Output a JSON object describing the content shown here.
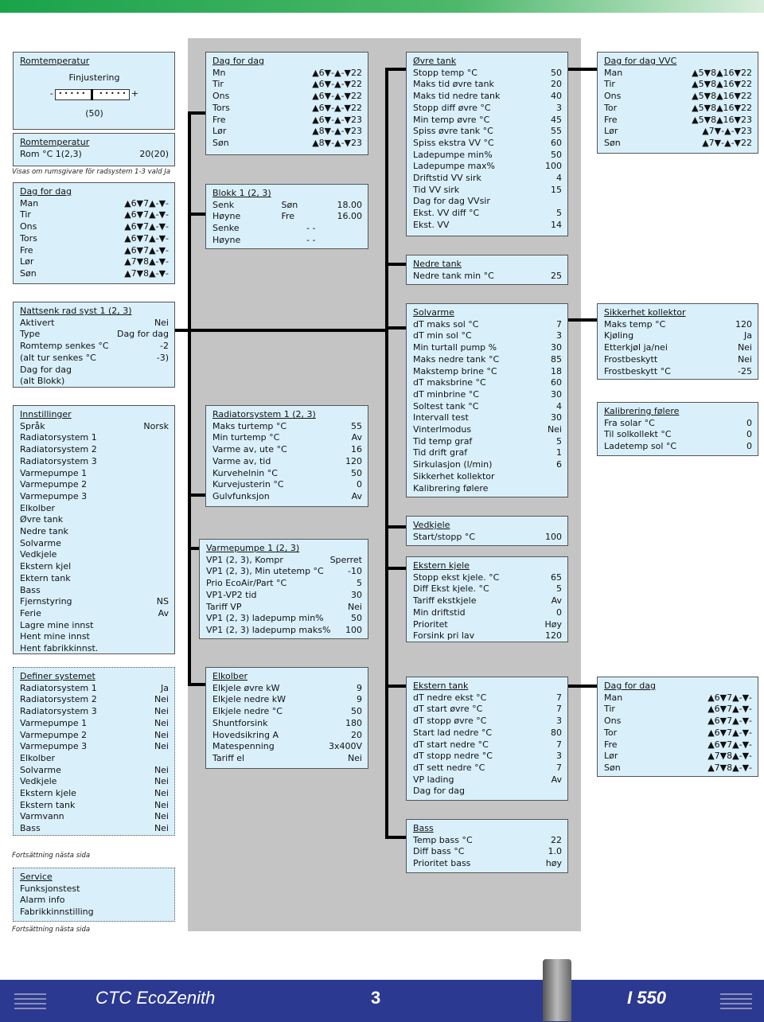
{
  "fine": {
    "title": "Romtemperatur",
    "subtitle": "Finjustering",
    "minus": "-",
    "plus": "+",
    "dots": "• • • • •",
    "value": "(50)"
  },
  "room": {
    "title": "Romtemperatur",
    "label": "Rom °C 1(2,3)",
    "value": "20(20)"
  },
  "room_note": "Visas om rumsgivare för radsystem 1-3 vald Ja",
  "cont_note_1": "Fortsättning nästa sida",
  "cont_note_2": "Fortsättning nästa sida",
  "boxes": [
    {
      "id": "dag-for-dag-1",
      "title": "Dag for dag",
      "rows": [
        [
          "Man",
          "",
          "▲6▼7▲-▼-"
        ],
        [
          "Tir",
          "",
          "▲6▼7▲-▼-"
        ],
        [
          "Ons",
          "",
          "▲6▼7▲-▼-"
        ],
        [
          "Tors",
          "",
          "▲6▼7▲-▼-"
        ],
        [
          "Fre",
          "",
          "▲6▼7▲-▼-"
        ],
        [
          "Lør",
          "",
          "▲7▼8▲-▼-"
        ],
        [
          "Søn",
          "",
          "▲7▼8▲-▼-"
        ]
      ]
    },
    {
      "id": "nattsenk",
      "title": "Nattsenk rad syst 1 (2, 3)",
      "rows": [
        [
          "Aktivert",
          "",
          "Nei"
        ],
        [
          "Type",
          "",
          "Dag for dag"
        ],
        [
          "Romtemp senkes °C",
          "",
          "-2"
        ],
        [
          "(alt tur senkes °C",
          "",
          "-3)"
        ],
        [
          "Dag for dag",
          "",
          ""
        ],
        [
          "(alt Blokk)",
          "",
          ""
        ]
      ]
    },
    {
      "id": "innstillinger",
      "title": "Innstillinger",
      "rows": [
        [
          "Språk",
          "",
          "Norsk"
        ],
        [
          "Radiatorsystem 1",
          "",
          ""
        ],
        [
          "Radiatorsystem 2",
          "",
          ""
        ],
        [
          "Radiatorsystem 3",
          "",
          ""
        ],
        [
          "Varmepumpe 1",
          "",
          ""
        ],
        [
          "Varmepumpe 2",
          "",
          ""
        ],
        [
          "Varmepumpe 3",
          "",
          ""
        ],
        [
          "Elkolber",
          "",
          ""
        ],
        [
          "Øvre tank",
          "",
          ""
        ],
        [
          "Nedre tank",
          "",
          ""
        ],
        [
          "Solvarme",
          "",
          ""
        ],
        [
          "Vedkjele",
          "",
          ""
        ],
        [
          "Ekstern kjel",
          "",
          ""
        ],
        [
          "Ektern tank",
          "",
          ""
        ],
        [
          "Bass",
          "",
          ""
        ],
        [
          "Fjernstyring",
          "",
          "NS"
        ],
        [
          "Ferie",
          "",
          "Av"
        ],
        [
          "Lagre mine innst",
          "",
          ""
        ],
        [
          "Hent mine innst",
          "",
          ""
        ],
        [
          "Hent fabrikkinnst.",
          "",
          ""
        ]
      ]
    },
    {
      "id": "definer",
      "title": "Definer systemet",
      "dotted": true,
      "rows": [
        [
          "Radiatorsystem 1",
          "",
          "Ja"
        ],
        [
          "Radiatorsystem 2",
          "",
          "Nei"
        ],
        [
          "Radiatorsystem 3",
          "",
          "Nei"
        ],
        [
          "Varmepumpe 1",
          "",
          "Nei"
        ],
        [
          "Varmepumpe 2",
          "",
          "Nei"
        ],
        [
          "Varmepumpe 3",
          "",
          "Nei"
        ],
        [
          "Elkolber",
          "",
          ""
        ],
        [
          "Solvarme",
          "",
          "Nei"
        ],
        [
          "Vedkjele",
          "",
          "Nei"
        ],
        [
          "Ekstern kjele",
          "",
          "Nei"
        ],
        [
          "Ekstern tank",
          "",
          "Nei"
        ],
        [
          "Varmvann",
          "",
          "Nei"
        ],
        [
          "Bass",
          "",
          "Nei"
        ]
      ]
    },
    {
      "id": "service",
      "title": "Service",
      "dotted": true,
      "rows": [
        [
          "Funksjonstest",
          "",
          ""
        ],
        [
          "Alarm info",
          "",
          ""
        ],
        [
          "Fabrikkinnstilling",
          "",
          ""
        ]
      ]
    },
    {
      "id": "dag-for-dag-2",
      "title": "Dag for dag",
      "rows": [
        [
          "Mn",
          "",
          "▲6▼-▲-▼22"
        ],
        [
          "Tir",
          "",
          "▲6▼-▲-▼22"
        ],
        [
          "Ons",
          "",
          "▲6▼-▲-▼22"
        ],
        [
          "Tors",
          "",
          "▲6▼-▲-▼22"
        ],
        [
          "Fre",
          "",
          "▲6▼-▲-▼23"
        ],
        [
          "Lør",
          "",
          "▲8▼-▲-▼23"
        ],
        [
          "Søn",
          "",
          "▲8▼-▲-▼23"
        ]
      ]
    },
    {
      "id": "blokk",
      "title": "Blokk 1 (2, 3)",
      "rows": [
        [
          "Senk",
          "Søn",
          "18.00"
        ],
        [
          "Høyne",
          "Fre",
          "16.00"
        ],
        [
          "Senke",
          "- -",
          ""
        ],
        [
          "Høyne",
          "- -",
          ""
        ]
      ]
    },
    {
      "id": "radiatorsystem",
      "title": "Radiatorsystem 1 (2, 3)",
      "rows": [
        [
          "Maks turtemp °C",
          "",
          "55"
        ],
        [
          "Min turtemp °C",
          "",
          "Av"
        ],
        [
          "Varme av, ute °C",
          "",
          "16"
        ],
        [
          "Varme av, tid",
          "",
          "120"
        ],
        [
          "Kurvehelnin °C",
          "",
          "50"
        ],
        [
          "Kurvejusterin °C",
          "",
          "0"
        ],
        [
          "Gulvfunksjon",
          "",
          "Av"
        ]
      ]
    },
    {
      "id": "varmepumpe",
      "title": "Varmepumpe 1 (2, 3)",
      "rows": [
        [
          "VP1 (2, 3), Kompr",
          "",
          "Sperret"
        ],
        [
          "VP1 (2, 3), Min utetemp °C",
          "",
          "-10"
        ],
        [
          "Prio EcoAir/Part °C",
          "",
          "5"
        ],
        [
          "VP1-VP2 tid",
          "",
          "30"
        ],
        [
          "Tariff VP",
          "",
          "Nei"
        ],
        [
          "VP1 (2, 3) ladepump min%",
          "",
          "50"
        ],
        [
          "VP1 (2, 3) ladepump maks%",
          "",
          "100"
        ]
      ]
    },
    {
      "id": "elkolber",
      "title": "Elkolber",
      "rows": [
        [
          "Elkjele øvre kW",
          "",
          "9"
        ],
        [
          "Elkjele nedre kW",
          "",
          "9"
        ],
        [
          "Elkjele nedre °C",
          "",
          "50"
        ],
        [
          "Shuntforsink",
          "",
          "180"
        ],
        [
          "Hovedsikring A",
          "",
          "20"
        ],
        [
          "Matespenning",
          "",
          "3x400V"
        ],
        [
          "Tariff el",
          "",
          "Nei"
        ]
      ]
    },
    {
      "id": "ovre-tank",
      "title": "Øvre tank",
      "rows": [
        [
          "Stopp temp °C",
          "",
          "50"
        ],
        [
          "Maks tid øvre tank",
          "",
          "20"
        ],
        [
          "Maks tid nedre tank",
          "",
          "40"
        ],
        [
          "Stopp diff øvre °C",
          "",
          "3"
        ],
        [
          "Min temp øvre °C",
          "",
          "45"
        ],
        [
          "Spiss øvre tank °C",
          "",
          "55"
        ],
        [
          "Spiss ekstra VV °C",
          "",
          "60"
        ],
        [
          "Ladepumpe min%",
          "",
          "50"
        ],
        [
          "Ladepumpe max%",
          "",
          "100"
        ],
        [
          "Driftstid VV sirk",
          "",
          "4"
        ],
        [
          "Tid  VV sirk",
          "",
          "15"
        ],
        [
          "Dag for dag VVsir",
          "",
          ""
        ],
        [
          "Ekst. VV diff °C",
          "",
          "5"
        ],
        [
          "Ekst. VV",
          "",
          "14"
        ]
      ]
    },
    {
      "id": "nedre-tank",
      "title": "Nedre tank",
      "rows": [
        [
          "Nedre tank min °C",
          "",
          "25"
        ]
      ]
    },
    {
      "id": "solvarme",
      "title": "Solvarme",
      "rows": [
        [
          "dT maks sol °C",
          "",
          "7"
        ],
        [
          "dT min sol °C",
          "",
          "3"
        ],
        [
          "Min turtall pump %",
          "",
          "30"
        ],
        [
          "Maks nedre tank °C",
          "",
          "85"
        ],
        [
          "Makstemp brine °C",
          "",
          "18"
        ],
        [
          "dT maksbrine °C",
          "",
          "60"
        ],
        [
          "dT minbrine °C",
          "",
          "30"
        ],
        [
          "Soltest tank °C",
          "",
          "4"
        ],
        [
          "Intervall test",
          "",
          "30"
        ],
        [
          "Vinterlmodus",
          "",
          "Nei"
        ],
        [
          "Tid temp graf",
          "",
          "5"
        ],
        [
          "Tid drift graf",
          "",
          "1"
        ],
        [
          "Sirkulasjon (l/min)",
          "",
          "6"
        ],
        [
          "Sikkerhet kollektor",
          "",
          ""
        ],
        [
          "Kalibrering følere",
          "",
          ""
        ]
      ]
    },
    {
      "id": "vedkjele",
      "title": "Vedkjele",
      "rows": [
        [
          "Start/stopp °C",
          "",
          "100"
        ]
      ]
    },
    {
      "id": "ekstern-kjele",
      "title": "Ekstern kjele",
      "rows": [
        [
          "Stopp ekst kjele. °C",
          "",
          "65"
        ],
        [
          "Diff Ekst kjele. °C",
          "",
          "5"
        ],
        [
          "Tariff ekstkjele",
          "",
          "Av"
        ],
        [
          "Min driftstid",
          "",
          "0"
        ],
        [
          "Prioritet",
          "",
          "Høy"
        ],
        [
          "Forsink pri lav",
          "",
          "120"
        ]
      ]
    },
    {
      "id": "ekstern-tank",
      "title": "Ekstern tank",
      "rows": [
        [
          "dT nedre ekst °C",
          "",
          "7"
        ],
        [
          "dT start øvre °C",
          "",
          "7"
        ],
        [
          "dT stopp øvre °C",
          "",
          "3"
        ],
        [
          "Start lad nedre °C",
          "",
          "80"
        ],
        [
          "dT start nedre °C",
          "",
          "7"
        ],
        [
          "dT stopp nedre °C",
          "",
          "3"
        ],
        [
          "dT sett nedre °C",
          "",
          "7"
        ],
        [
          "VP lading",
          "",
          "Av"
        ],
        [
          "Dag for dag",
          "",
          ""
        ]
      ]
    },
    {
      "id": "bass",
      "title": "Bass",
      "rows": [
        [
          "Temp bass  °C",
          "",
          "22"
        ],
        [
          "Diff bass °C",
          "",
          "1.0"
        ],
        [
          "Prioritet bass",
          "",
          "høy"
        ]
      ]
    },
    {
      "id": "dag-for-dag-vvc",
      "title": "Dag for dag VVC",
      "rows": [
        [
          "Man",
          "",
          "▲5▼8▲16▼22"
        ],
        [
          "Tir",
          "",
          "▲5▼8▲16▼22"
        ],
        [
          "Ons",
          "",
          "▲5▼8▲16▼22"
        ],
        [
          "Tor",
          "",
          "▲5▼8▲16▼22"
        ],
        [
          "Fre",
          "",
          "▲5▼8▲16▼23"
        ],
        [
          "Lør",
          "",
          "▲7▼-▲-▼23"
        ],
        [
          "Søn",
          "",
          "▲7▼-▲-▼22"
        ]
      ]
    },
    {
      "id": "sikkerhet",
      "title": "Sikkerhet kollektor",
      "rows": [
        [
          "Maks temp °C",
          "",
          "120"
        ],
        [
          "Kjøling",
          "",
          "Ja"
        ],
        [
          "Etterkjøl ja/nei",
          "",
          "Nei"
        ],
        [
          "Frostbeskytt",
          "",
          "Nei"
        ],
        [
          "Frostbeskytt °C",
          "",
          "-25"
        ]
      ]
    },
    {
      "id": "kalibrering",
      "title": "Kalibrering følere",
      "rows": [
        [
          "Fra solar °C",
          "",
          "0"
        ],
        [
          "Til solkollekt °C",
          "",
          "0"
        ],
        [
          "Ladetemp sol °C",
          "",
          "0"
        ]
      ]
    },
    {
      "id": "dag-for-dag-3",
      "title": "Dag for dag",
      "rows": [
        [
          "Man",
          "",
          "▲6▼7▲-▼-"
        ],
        [
          "Tir",
          "",
          "▲6▼7▲-▼-"
        ],
        [
          "Ons",
          "",
          "▲6▼7▲-▼-"
        ],
        [
          "Tor",
          "",
          "▲6▼7▲-▼-"
        ],
        [
          "Fre",
          "",
          "▲6▼7▲-▼-"
        ],
        [
          "Lør",
          "",
          "▲7▼8▲-▼-"
        ],
        [
          "Søn",
          "",
          "▲7▼8▲-▼-"
        ]
      ]
    }
  ],
  "footer": {
    "brand": "CTC EcoZenith",
    "page": "3",
    "model": "I 550"
  },
  "colors": {
    "box_fill": "#d9f0fb",
    "footer": "#2b3990",
    "top_bar": "#1aa34a",
    "panel": "#c4c4c4"
  }
}
